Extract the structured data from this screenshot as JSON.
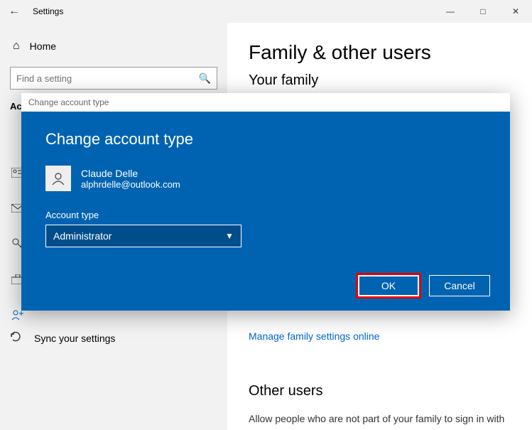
{
  "titlebar": {
    "title": "Settings"
  },
  "sidebar": {
    "home": "Home",
    "search_placeholder": "Find a setting",
    "heading_short": "Ac",
    "sync_label": "Sync your settings"
  },
  "content": {
    "h1": "Family & other users",
    "h2a": "Your family",
    "link": "Manage family settings online",
    "h2b": "Other users",
    "note": "Allow people who are not part of your family to sign in with"
  },
  "dialog": {
    "crumb": "Change account type",
    "title": "Change account type",
    "user_name": "Claude Delle",
    "user_email": "alphrdelle@outlook.com",
    "field_label": "Account type",
    "selected": "Administrator",
    "ok": "OK",
    "cancel": "Cancel"
  }
}
